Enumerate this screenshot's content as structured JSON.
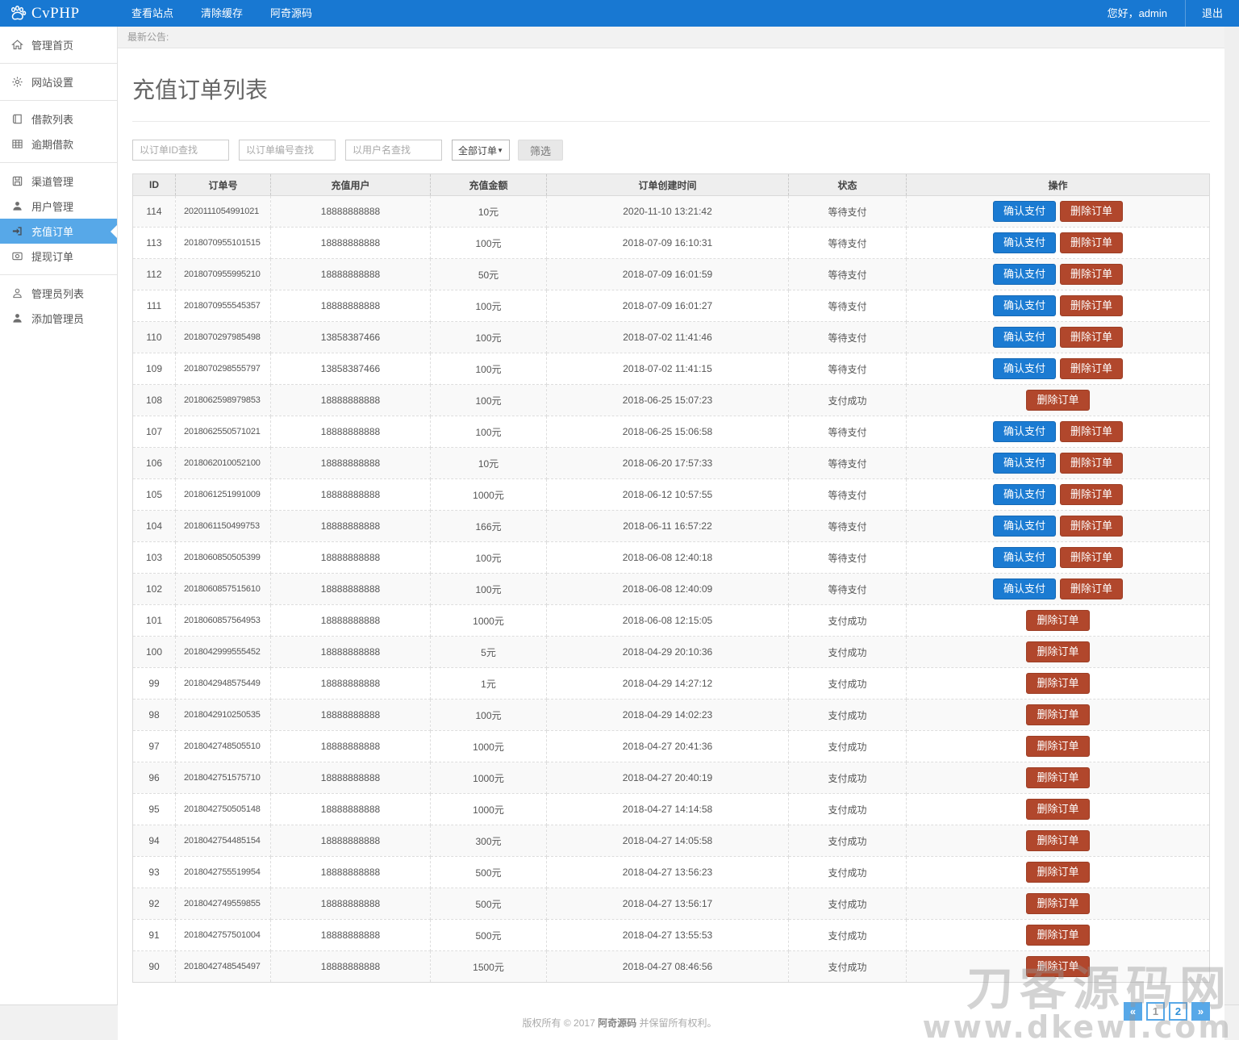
{
  "navbar": {
    "logo": "CvPHP",
    "menu": [
      "查看站点",
      "清除缓存",
      "阿奇源码"
    ],
    "greeting": "您好，admin",
    "logout": "退出"
  },
  "announcement": "最新公告:",
  "sidebar": {
    "groups": [
      {
        "items": [
          {
            "icon": "home",
            "label": "管理首页",
            "active": false
          }
        ]
      },
      {
        "items": [
          {
            "icon": "gear",
            "label": "网站设置",
            "active": false
          }
        ]
      },
      {
        "items": [
          {
            "icon": "book",
            "label": "借款列表",
            "active": false
          },
          {
            "icon": "table",
            "label": "逾期借款",
            "active": false
          }
        ]
      },
      {
        "items": [
          {
            "icon": "save",
            "label": "渠道管理",
            "active": false
          },
          {
            "icon": "user",
            "label": "用户管理",
            "active": false
          },
          {
            "icon": "signin",
            "label": "充值订单",
            "active": true
          },
          {
            "icon": "money",
            "label": "提现订单",
            "active": false
          }
        ]
      },
      {
        "items": [
          {
            "icon": "user-outline",
            "label": "管理员列表",
            "active": false
          },
          {
            "icon": "user-add",
            "label": "添加管理员",
            "active": false
          }
        ]
      }
    ]
  },
  "page": {
    "title": "充值订单列表",
    "filters": {
      "id_placeholder": "以订单ID查找",
      "orderno_placeholder": "以订单编号查找",
      "username_placeholder": "以用户名查找",
      "select_value": "全部订单",
      "filter_button": "筛选"
    },
    "table": {
      "headers": [
        "ID",
        "订单号",
        "充值用户",
        "充值金额",
        "订单创建时间",
        "状态",
        "操作"
      ],
      "action_labels": {
        "confirm": "确认支付",
        "delete": "删除订单"
      },
      "rows": [
        {
          "id": "114",
          "order_no": "2020111054991021",
          "user": "18888888888",
          "amount": "10元",
          "created": "2020-11-10 13:21:42",
          "status": "等待支付",
          "actions": [
            "confirm",
            "delete"
          ]
        },
        {
          "id": "113",
          "order_no": "2018070955101515",
          "user": "18888888888",
          "amount": "100元",
          "created": "2018-07-09 16:10:31",
          "status": "等待支付",
          "actions": [
            "confirm",
            "delete"
          ]
        },
        {
          "id": "112",
          "order_no": "2018070955995210",
          "user": "18888888888",
          "amount": "50元",
          "created": "2018-07-09 16:01:59",
          "status": "等待支付",
          "actions": [
            "confirm",
            "delete"
          ]
        },
        {
          "id": "111",
          "order_no": "2018070955545357",
          "user": "18888888888",
          "amount": "100元",
          "created": "2018-07-09 16:01:27",
          "status": "等待支付",
          "actions": [
            "confirm",
            "delete"
          ]
        },
        {
          "id": "110",
          "order_no": "2018070297985498",
          "user": "13858387466",
          "amount": "100元",
          "created": "2018-07-02 11:41:46",
          "status": "等待支付",
          "actions": [
            "confirm",
            "delete"
          ]
        },
        {
          "id": "109",
          "order_no": "2018070298555797",
          "user": "13858387466",
          "amount": "100元",
          "created": "2018-07-02 11:41:15",
          "status": "等待支付",
          "actions": [
            "confirm",
            "delete"
          ]
        },
        {
          "id": "108",
          "order_no": "2018062598979853",
          "user": "18888888888",
          "amount": "100元",
          "created": "2018-06-25 15:07:23",
          "status": "支付成功",
          "actions": [
            "delete"
          ]
        },
        {
          "id": "107",
          "order_no": "2018062550571021",
          "user": "18888888888",
          "amount": "100元",
          "created": "2018-06-25 15:06:58",
          "status": "等待支付",
          "actions": [
            "confirm",
            "delete"
          ]
        },
        {
          "id": "106",
          "order_no": "2018062010052100",
          "user": "18888888888",
          "amount": "10元",
          "created": "2018-06-20 17:57:33",
          "status": "等待支付",
          "actions": [
            "confirm",
            "delete"
          ]
        },
        {
          "id": "105",
          "order_no": "2018061251991009",
          "user": "18888888888",
          "amount": "1000元",
          "created": "2018-06-12 10:57:55",
          "status": "等待支付",
          "actions": [
            "confirm",
            "delete"
          ]
        },
        {
          "id": "104",
          "order_no": "2018061150499753",
          "user": "18888888888",
          "amount": "166元",
          "created": "2018-06-11 16:57:22",
          "status": "等待支付",
          "actions": [
            "confirm",
            "delete"
          ]
        },
        {
          "id": "103",
          "order_no": "2018060850505399",
          "user": "18888888888",
          "amount": "100元",
          "created": "2018-06-08 12:40:18",
          "status": "等待支付",
          "actions": [
            "confirm",
            "delete"
          ]
        },
        {
          "id": "102",
          "order_no": "2018060857515610",
          "user": "18888888888",
          "amount": "100元",
          "created": "2018-06-08 12:40:09",
          "status": "等待支付",
          "actions": [
            "confirm",
            "delete"
          ]
        },
        {
          "id": "101",
          "order_no": "2018060857564953",
          "user": "18888888888",
          "amount": "1000元",
          "created": "2018-06-08 12:15:05",
          "status": "支付成功",
          "actions": [
            "delete"
          ]
        },
        {
          "id": "100",
          "order_no": "2018042999555452",
          "user": "18888888888",
          "amount": "5元",
          "created": "2018-04-29 20:10:36",
          "status": "支付成功",
          "actions": [
            "delete"
          ]
        },
        {
          "id": "99",
          "order_no": "2018042948575449",
          "user": "18888888888",
          "amount": "1元",
          "created": "2018-04-29 14:27:12",
          "status": "支付成功",
          "actions": [
            "delete"
          ]
        },
        {
          "id": "98",
          "order_no": "2018042910250535",
          "user": "18888888888",
          "amount": "100元",
          "created": "2018-04-29 14:02:23",
          "status": "支付成功",
          "actions": [
            "delete"
          ]
        },
        {
          "id": "97",
          "order_no": "2018042748505510",
          "user": "18888888888",
          "amount": "1000元",
          "created": "2018-04-27 20:41:36",
          "status": "支付成功",
          "actions": [
            "delete"
          ]
        },
        {
          "id": "96",
          "order_no": "2018042751575710",
          "user": "18888888888",
          "amount": "1000元",
          "created": "2018-04-27 20:40:19",
          "status": "支付成功",
          "actions": [
            "delete"
          ]
        },
        {
          "id": "95",
          "order_no": "2018042750505148",
          "user": "18888888888",
          "amount": "1000元",
          "created": "2018-04-27 14:14:58",
          "status": "支付成功",
          "actions": [
            "delete"
          ]
        },
        {
          "id": "94",
          "order_no": "2018042754485154",
          "user": "18888888888",
          "amount": "300元",
          "created": "2018-04-27 14:05:58",
          "status": "支付成功",
          "actions": [
            "delete"
          ]
        },
        {
          "id": "93",
          "order_no": "2018042755519954",
          "user": "18888888888",
          "amount": "500元",
          "created": "2018-04-27 13:56:23",
          "status": "支付成功",
          "actions": [
            "delete"
          ]
        },
        {
          "id": "92",
          "order_no": "2018042749559855",
          "user": "18888888888",
          "amount": "500元",
          "created": "2018-04-27 13:56:17",
          "status": "支付成功",
          "actions": [
            "delete"
          ]
        },
        {
          "id": "91",
          "order_no": "2018042757501004",
          "user": "18888888888",
          "amount": "500元",
          "created": "2018-04-27 13:55:53",
          "status": "支付成功",
          "actions": [
            "delete"
          ]
        },
        {
          "id": "90",
          "order_no": "2018042748545497",
          "user": "18888888888",
          "amount": "1500元",
          "created": "2018-04-27 08:46:56",
          "status": "支付成功",
          "actions": [
            "delete"
          ]
        }
      ]
    },
    "pagination": {
      "prev": "«",
      "pages": [
        {
          "label": "1",
          "current": true
        },
        {
          "label": "2",
          "current": false
        }
      ],
      "next": "»"
    }
  },
  "footer": {
    "prefix": "版权所有 © 2017",
    "brand": "阿奇源码",
    "suffix": "并保留所有权利。"
  },
  "watermark": {
    "line1": "刀客源码网",
    "line2": "www.dkewl.com"
  },
  "colors": {
    "navbar_blue": "#1878d2",
    "active_item_blue": "#57a8e8",
    "confirm_button": "#1b7bd2",
    "delete_button": "#b1472c",
    "status_waiting": "等待支付",
    "status_paid": "支付成功"
  }
}
